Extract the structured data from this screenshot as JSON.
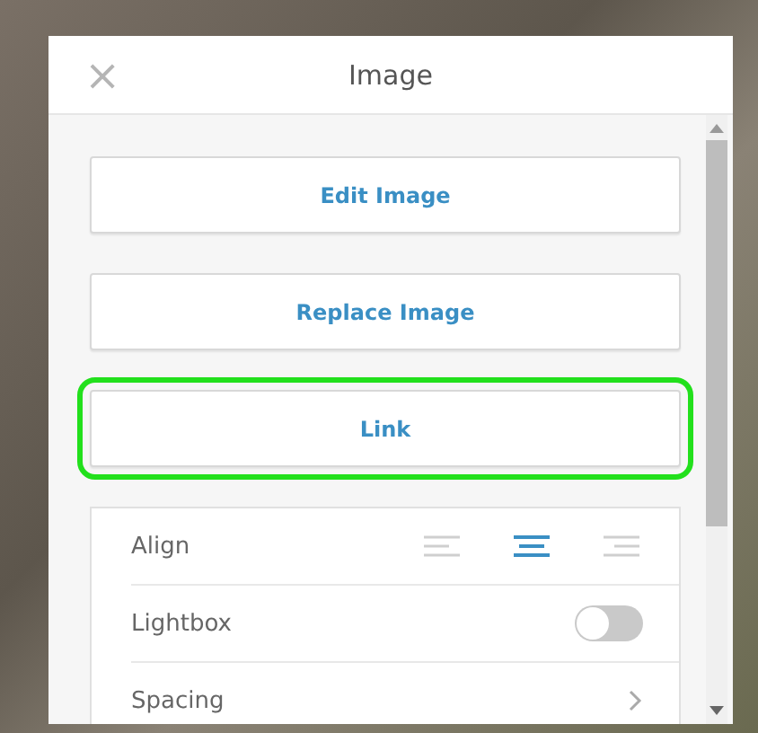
{
  "panel": {
    "title": "Image",
    "close": "×"
  },
  "buttons": [
    {
      "label": "Edit Image",
      "highlighted": false
    },
    {
      "label": "Replace Image",
      "highlighted": false
    },
    {
      "label": "Link",
      "highlighted": true
    }
  ],
  "settings": [
    {
      "kind": "align",
      "label": "Align",
      "options": [
        {
          "kind": "left",
          "selected": false
        },
        {
          "kind": "center",
          "selected": true
        },
        {
          "kind": "right",
          "selected": false
        }
      ]
    },
    {
      "kind": "toggle",
      "label": "Lightbox",
      "on": false
    },
    {
      "kind": "link",
      "label": "Spacing"
    }
  ]
}
